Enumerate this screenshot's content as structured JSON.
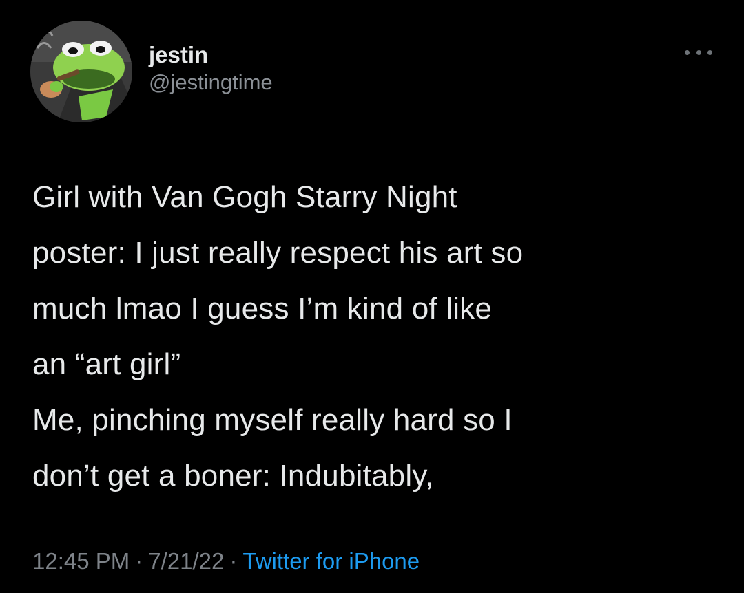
{
  "user": {
    "display_name": "jestin",
    "handle": "@jestingtime"
  },
  "tweet": {
    "lines": [
      "Girl with Van Gogh Starry Night",
      "poster: I just really respect his art so",
      "much lmao I guess I’m kind of like",
      "an “art girl”",
      "Me, pinching myself really hard so I",
      "don’t get a boner: Indubitably,"
    ]
  },
  "meta": {
    "time": "12:45 PM",
    "separator": "·",
    "date": "7/21/22",
    "source": "Twitter for iPhone"
  },
  "icons": {
    "more": "more-horizontal-icon"
  },
  "colors": {
    "background": "#000000",
    "text": "#e7e9ea",
    "secondary": "#7e8389",
    "link": "#1d9bf0"
  }
}
